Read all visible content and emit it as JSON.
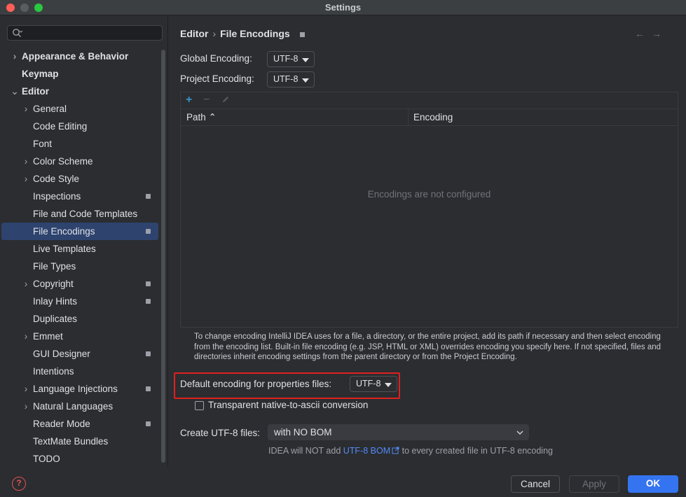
{
  "window": {
    "title": "Settings"
  },
  "search": {
    "placeholder": ""
  },
  "sidebar": {
    "items": [
      {
        "label": "Appearance & Behavior",
        "chevron": "›",
        "bold": true
      },
      {
        "label": "Keymap",
        "bold": true
      },
      {
        "label": "Editor",
        "chevron": "⌄",
        "bold": true
      },
      {
        "label": "General",
        "chevron": "›"
      },
      {
        "label": "Code Editing"
      },
      {
        "label": "Font"
      },
      {
        "label": "Color Scheme",
        "chevron": "›"
      },
      {
        "label": "Code Style",
        "chevron": "›"
      },
      {
        "label": "Inspections",
        "mark": true
      },
      {
        "label": "File and Code Templates"
      },
      {
        "label": "File Encodings",
        "mark": true,
        "selected": true
      },
      {
        "label": "Live Templates"
      },
      {
        "label": "File Types"
      },
      {
        "label": "Copyright",
        "chevron": "›",
        "mark": true
      },
      {
        "label": "Inlay Hints",
        "mark": true
      },
      {
        "label": "Duplicates"
      },
      {
        "label": "Emmet",
        "chevron": "›"
      },
      {
        "label": "GUI Designer",
        "mark": true
      },
      {
        "label": "Intentions"
      },
      {
        "label": "Language Injections",
        "chevron": "›",
        "mark": true
      },
      {
        "label": "Natural Languages",
        "chevron": "›"
      },
      {
        "label": "Reader Mode",
        "mark": true
      },
      {
        "label": "TextMate Bundles"
      },
      {
        "label": "TODO"
      }
    ]
  },
  "breadcrumb": {
    "parent": "Editor",
    "separator": "›",
    "current": "File Encodings"
  },
  "nav": {
    "back": "←",
    "forward": "→"
  },
  "global_encoding": {
    "label": "Global Encoding:",
    "value": "UTF-8"
  },
  "project_encoding": {
    "label": "Project Encoding:",
    "value": "UTF-8"
  },
  "table": {
    "add": "+",
    "remove": "−",
    "columns": [
      "Path ⌃",
      "Encoding"
    ],
    "empty_text": "Encodings are not configured"
  },
  "hint_text": "To change encoding IntelliJ IDEA uses for a file, a directory, or the entire project, add its path if necessary and then select encoding from the encoding list. Built-in file encoding (e.g. JSP, HTML or XML) overrides encoding you specify here. If not specified, files and directories inherit encoding settings from the parent directory or from the Project Encoding.",
  "properties_encoding": {
    "label": "Default encoding for properties files:",
    "value": "UTF-8"
  },
  "transparent_conversion": {
    "label": "Transparent native-to-ascii conversion",
    "checked": false
  },
  "create_utf8": {
    "label": "Create UTF-8 files:",
    "value": "with NO BOM",
    "note_before": "IDEA will NOT add ",
    "note_link": "UTF-8 BOM",
    "note_after": " to every created file in UTF-8 encoding"
  },
  "buttons": {
    "help": "?",
    "cancel": "Cancel",
    "apply": "Apply",
    "ok": "OK"
  },
  "colors": {
    "accent": "#3574f0",
    "selection": "#2e436e",
    "link": "#548af7",
    "highlight_border": "#e02020"
  }
}
